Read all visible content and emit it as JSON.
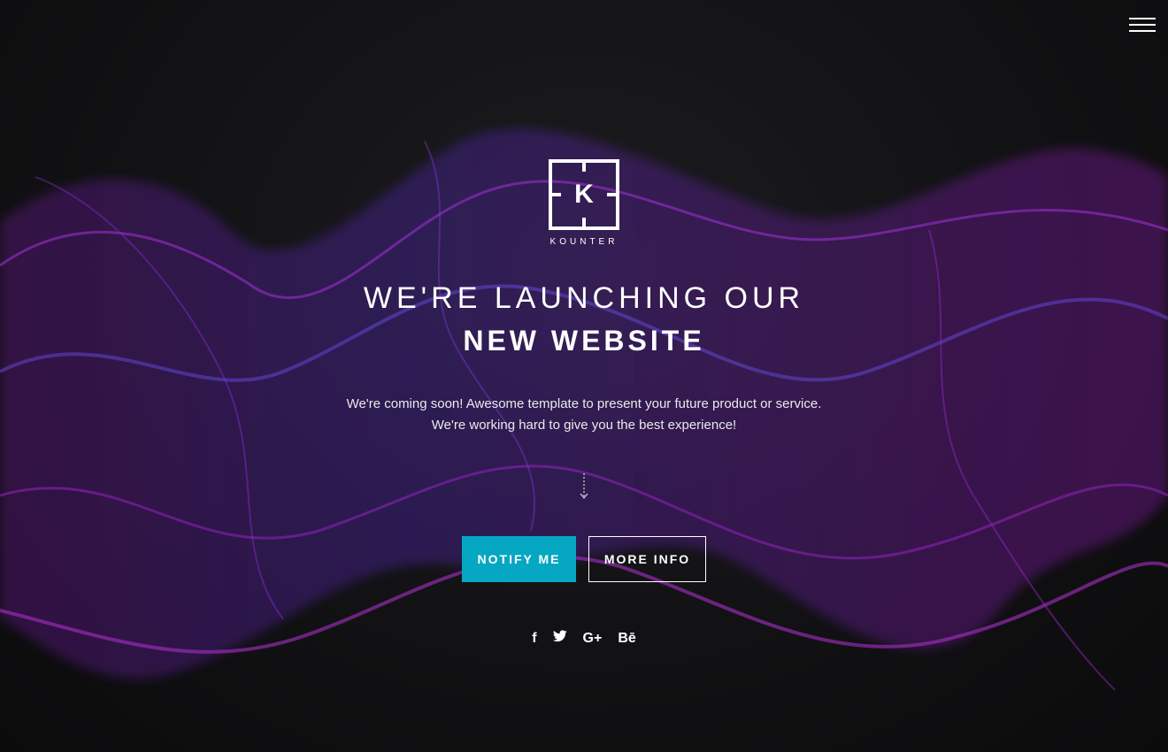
{
  "brand": {
    "name": "KOUNTER",
    "logo_letter": "K"
  },
  "hero": {
    "headline_line1": "WE'RE LAUNCHING OUR",
    "headline_line2": "NEW WEBSITE",
    "description_line1": "We're coming soon! Awesome template to present your future product or service.",
    "description_line2": "We're working hard to give you the best experience!"
  },
  "buttons": {
    "notify": "NOTIFY ME",
    "more_info": "MORE INFO"
  },
  "social": [
    {
      "name": "facebook-icon",
      "glyph": "f"
    },
    {
      "name": "twitter-icon",
      "glyph": "🐦"
    },
    {
      "name": "google-plus-icon",
      "glyph": "G+"
    },
    {
      "name": "behance-icon",
      "glyph": "Bē"
    }
  ],
  "colors": {
    "accent": "#06a7c2",
    "wave_purple": "#8a1fb0",
    "wave_blue": "#4a3ad0",
    "background": "#121214"
  },
  "menu": {
    "icon": "hamburger-icon"
  }
}
